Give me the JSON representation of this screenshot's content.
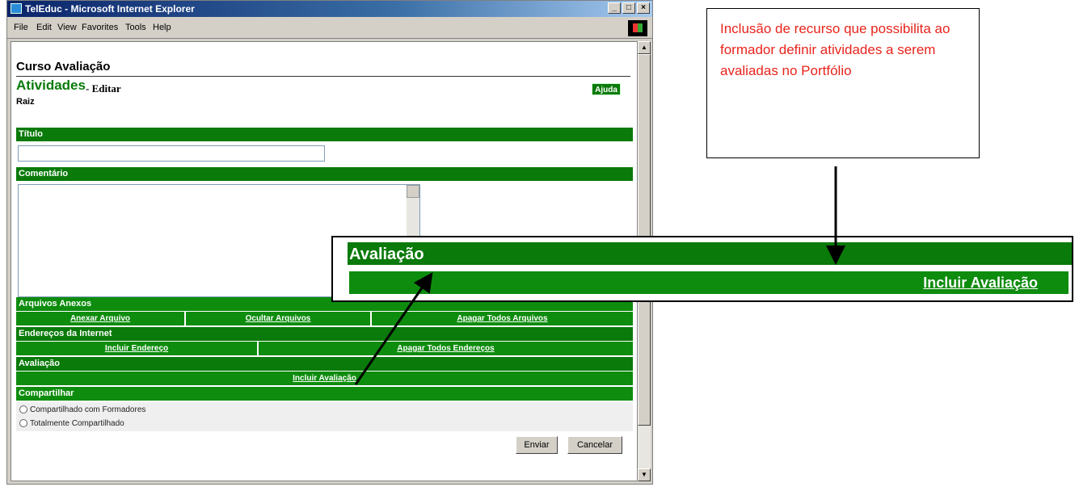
{
  "window": {
    "title": "TelEduc - Microsoft Internet Explorer",
    "controls": [
      "_",
      "□",
      "×"
    ],
    "menu": [
      "File",
      "Edit",
      "View",
      "Favorites",
      "Tools",
      "Help"
    ]
  },
  "page": {
    "course_title": "Curso Avaliação",
    "section_title": "Atividades",
    "section_action": "- Editar",
    "breadcrumb": "Raiz",
    "help_button": "Ajuda",
    "titulo_header": "Título",
    "comentario_header": "Comentário",
    "arquivos_header": "Arquivos Anexos",
    "arquivos_actions": [
      "Anexar Arquivo",
      "Ocultar Arquivos",
      "Apagar Todos Arquivos"
    ],
    "enderecos_header": "Endereços da Internet",
    "enderecos_actions": [
      "Incluir Endereço",
      "Apagar Todos Endereços"
    ],
    "avaliacao_header": "Avaliação",
    "avaliacao_action": "Incluir Avaliação",
    "compartilhar_header": "Compartilhar",
    "share_options": [
      "Compartilhado com Formadores",
      "Totalmente Compartilhado"
    ],
    "submit_button": "Enviar",
    "cancel_button": "Cancelar"
  },
  "zoom_panel": {
    "header": "Avaliação",
    "link": "Incluir Avaliação"
  },
  "callout": {
    "text": "Inclusão de recurso que possibilita ao formador definir atividades a serem avaliadas no Portfólio"
  },
  "colors": {
    "green_dark": "#0a7a0a",
    "green": "#0e8c0e",
    "callout_text": "#e8241c"
  }
}
